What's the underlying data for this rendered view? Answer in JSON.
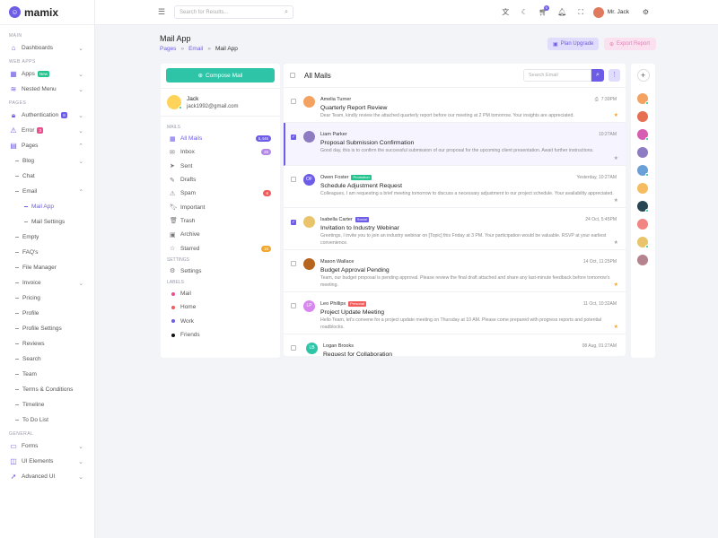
{
  "app": {
    "logo_text": "mamix"
  },
  "sidebar": {
    "sections": {
      "main": "MAIN",
      "web_apps": "WEB APPS",
      "pages": "PAGES",
      "general": "GENERAL"
    },
    "dashboards": "Dashboards",
    "apps": "Apps",
    "apps_badge": "New",
    "nested_menu": "Nested Menu",
    "authentication": "Authentication",
    "authentication_badge": "8",
    "error": "Error",
    "error_badge": "3",
    "pages": "Pages",
    "blog": "Blog",
    "chat": "Chat",
    "email": "Email",
    "mail_app": "Mail App",
    "mail_settings": "Mail Settings",
    "empty": "Empty",
    "faqs": "FAQ's",
    "file_manager": "File Manager",
    "invoice": "Invoice",
    "pricing": "Pricing",
    "profile": "Profile",
    "profile_settings": "Profile Settings",
    "reviews": "Reviews",
    "search": "Search",
    "team": "Team",
    "terms": "Terms & Conditions",
    "timeline": "Timeline",
    "todo": "To Do List",
    "forms": "Forms",
    "ui_elements": "UI Elements",
    "advanced_ui": "Advanced UI"
  },
  "topbar": {
    "search_placeholder": "Search for Results...",
    "notif_count": "5",
    "user_name": "Mr. Jack"
  },
  "page": {
    "title": "Mail App",
    "breadcrumb": [
      "Pages",
      "Email",
      "Mail App"
    ],
    "plan_upgrade": "Plan Upgrade",
    "export_report": "Export Report"
  },
  "mail_left": {
    "compose": "Compose Mail",
    "user_name": "Jack",
    "user_email": "jack1992@gmail.com",
    "sec_mails": "MAILS",
    "sec_settings": "SETTINGS",
    "sec_labels": "LABELS",
    "folders": [
      {
        "label": "All Mails",
        "count": "6,446",
        "color": "#6c5ce7"
      },
      {
        "label": "Inbox",
        "count": "26",
        "color": "#b388e9"
      },
      {
        "label": "Sent",
        "count": ""
      },
      {
        "label": "Drafts",
        "count": ""
      },
      {
        "label": "Spam",
        "count": "6",
        "color": "#f15b5b"
      },
      {
        "label": "Important",
        "count": ""
      },
      {
        "label": "Trash",
        "count": ""
      },
      {
        "label": "Archive",
        "count": ""
      },
      {
        "label": "Starred",
        "count": "15",
        "color": "#f0a830"
      }
    ],
    "settings": "Settings",
    "labels": [
      {
        "label": "Mail",
        "color": "#e84f8c"
      },
      {
        "label": "Home",
        "color": "#f15b5b"
      },
      {
        "label": "Work",
        "color": "#6c5ce7"
      },
      {
        "label": "Friends",
        "color": "#111111"
      }
    ]
  },
  "mail_list": {
    "title": "All Mails",
    "search_placeholder": "Search Email",
    "mails": [
      {
        "name": "Amelia Turner",
        "tag": "",
        "date": "7:30PM",
        "subject": "Quarterly Report Review",
        "text": "Dear Team, kindly review the attached quarterly report before our meeting at 2 PM tomorrow. Your insights are appreciated.",
        "checked": false,
        "starred": true,
        "initials": "",
        "av_color": "#f4a261"
      },
      {
        "name": "Liam Parker",
        "tag": "",
        "date": "10:27AM",
        "subject": "Proposal Submission Confirmation",
        "text": "Good day, this is to confirm the successful submission of our proposal for the upcoming client presentation. Await further instructions.",
        "checked": true,
        "starred": false,
        "initials": "",
        "av_color": "#8e7cc3"
      },
      {
        "name": "Owen Foster",
        "tag": "Promotion",
        "tag_color": "#23c48e",
        "date": "Yesterday, 10:27AM",
        "subject": "Schedule Adjustment Request",
        "text": "Colleagues, I am requesting a brief meeting tomorrow to discuss a necessary adjustment to our project schedule. Your availability appreciated.",
        "checked": false,
        "starred": false,
        "initials": "OF",
        "av_color": "#6c5ce7"
      },
      {
        "name": "Isabella Carter",
        "tag": "Social",
        "tag_color": "#6c5ce7",
        "date": "24 Oct, 5:45PM",
        "subject": "Invitation to Industry Webinar",
        "text": "Greetings, I invite you to join an industry webinar on [Topic] this Friday at 3 PM. Your participation would be valuable. RSVP at your earliest convenience.",
        "checked": true,
        "starred": false,
        "initials": "",
        "av_color": "#e9c46a"
      },
      {
        "name": "Mason Wallace",
        "tag": "",
        "date": "14 Oct, 11:25PM",
        "subject": "Budget Approval Pending",
        "text": "Team, our budget proposal is pending approval. Please review the final draft attached and share any last-minute feedback before tomorrow's meeting.",
        "checked": false,
        "starred": true,
        "initials": "",
        "av_color": "#b5651d"
      },
      {
        "name": "Leo Phillips",
        "tag": "Personal",
        "tag_color": "#f15b5b",
        "date": "11 Oct, 10:32AM",
        "subject": "Project Update Meeting",
        "text": "Hello Team, let's convene for a project update meeting on Thursday at 10 AM. Please come prepared with progress reports and potential roadblocks.",
        "checked": false,
        "starred": true,
        "initials": "LP",
        "av_color": "#d887f0"
      },
      {
        "name": "Logan Brooks",
        "tag": "",
        "date": "08 Aug, 01:27AM",
        "subject": "Request for Collaboration",
        "text": "",
        "checked": false,
        "starred": false,
        "initials": "LB",
        "av_color": "#2ec4a7"
      }
    ]
  },
  "contacts": {
    "add": "+",
    "avatar_colors": [
      "#f4a261",
      "#e76f51",
      "#d65db1",
      "#8e7cc3",
      "#6a9fd8",
      "#f6bd60",
      "#264653",
      "#f28482",
      "#e9c46a",
      "#b5838d"
    ]
  },
  "icons": {
    "logo": "smile-icon",
    "menu": "hamburger-icon",
    "search": "magnifier-icon",
    "translate": "translate-icon",
    "cart": "cart-icon",
    "bell": "bell-icon",
    "fullscreen": "fullscreen-icon",
    "settings": "gear-icon"
  }
}
